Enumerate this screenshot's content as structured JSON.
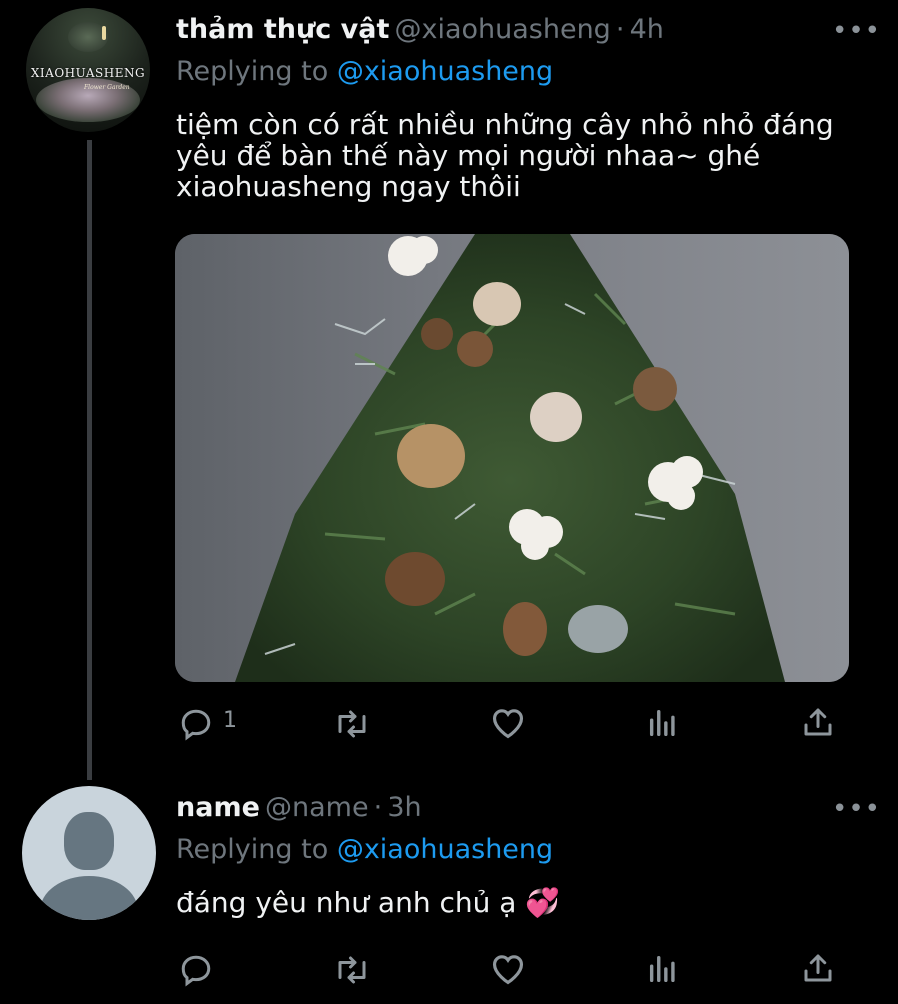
{
  "tweet1": {
    "avatar_brand": "XIAOHUASHENG",
    "avatar_script": "Flower Garden",
    "display_name": "thảm thực vật",
    "handle": "@xiaohuasheng",
    "sep": "·",
    "time": "4h",
    "more": "•••",
    "replying_label": "Replying to",
    "replying_to": "@xiaohuasheng",
    "text_lines": [
      "tiệm còn có rất nhiều những cây nhỏ nhỏ đáng",
      "yêu để bàn thế này mọi người nhaa~ ghé",
      "xiaohuasheng ngay thôii"
    ],
    "image_alt": "small tabletop christmas tree with pinecones and cotton",
    "actions": {
      "reply_count": "1"
    }
  },
  "tweet2": {
    "display_name": "name",
    "handle": "@name",
    "sep": "·",
    "time": "3h",
    "more": "•••",
    "replying_label": "Replying to",
    "replying_to": "@xiaohuasheng",
    "text": "đáng yêu như anh chủ ạ",
    "emoji": "💞"
  },
  "colors": {
    "background": "#000000",
    "accent": "#1d9bf0",
    "muted": "#6e767d",
    "text": "#f0f2f3"
  }
}
